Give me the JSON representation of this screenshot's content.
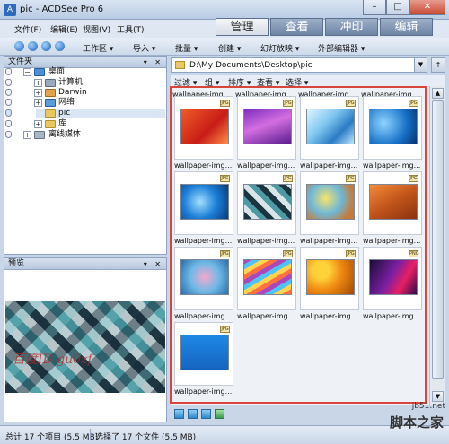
{
  "window": {
    "title": "pic - ACDSee Pro 6",
    "min": "–",
    "max": "□",
    "close": "✕"
  },
  "menu": [
    "文件(F)",
    "编辑(E)",
    "视图(V)",
    "工具(T)"
  ],
  "modes": [
    "管理",
    "查看",
    "冲印",
    "编辑"
  ],
  "toolbar": {
    "items": [
      "工作区 ▾",
      "导入 ▾",
      "批量 ▾",
      "创建 ▾",
      "幻灯放映 ▾",
      "外部编辑器 ▾"
    ]
  },
  "folders_panel": {
    "title": "文件夹",
    "controls": "▾ ✕",
    "tree": [
      {
        "label": "桌面",
        "expander": "−"
      },
      {
        "label": "计算机",
        "expander": "+"
      },
      {
        "label": "Darwin",
        "expander": "+"
      },
      {
        "label": "网络",
        "expander": "+"
      },
      {
        "label": "pic",
        "expander": ""
      },
      {
        "label": "库",
        "expander": "+"
      },
      {
        "label": "离线媒体",
        "expander": "+"
      }
    ]
  },
  "preview_panel": {
    "title": "预览",
    "controls": "▾ ✕",
    "watermark": "百度ID gu0zf"
  },
  "path": {
    "value": "D:\\My Documents\\Desktop\\pic",
    "arrow": "▼",
    "up": "↑"
  },
  "filter_bar": [
    "过滤 ▾",
    "组 ▾",
    "排序 ▾",
    "查看 ▾",
    "选择 ▾"
  ],
  "file_label": "wallpaper-img...",
  "badge": "JPG",
  "badge_png": "PNG",
  "thumbnails": [
    {
      "badge": "JPG"
    },
    {
      "badge": "JPG"
    },
    {
      "badge": "JPG"
    },
    {
      "badge": "JPG"
    },
    {
      "badge": "JPG"
    },
    {
      "badge": "JPG"
    },
    {
      "badge": "JPG"
    },
    {
      "badge": "JPG"
    },
    {
      "badge": "JPG"
    },
    {
      "badge": "JPG"
    },
    {
      "badge": "JPG"
    },
    {
      "badge": "PNG"
    },
    {
      "badge": "JPG"
    }
  ],
  "status": {
    "total": "总计 17 个项目 (5.5 MB)",
    "selected": "选择了 17 个文件 (5.5 MB)"
  },
  "site_watermark": {
    "line1": "jb51.net",
    "line2": "脚本之家"
  },
  "colors": {
    "accent": "#2d6bbf",
    "selection_frame": "#d9443b",
    "mode_active": "#d6dde7"
  }
}
